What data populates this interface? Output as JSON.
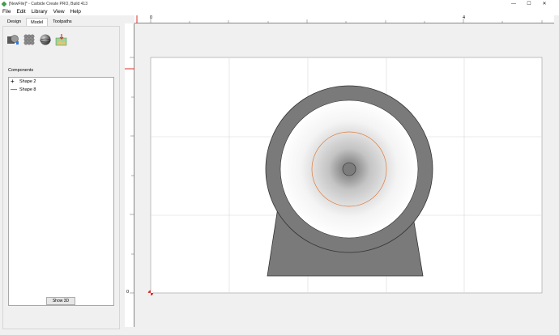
{
  "window": {
    "title": "[NewFile]* - Carbide Create PRO, Build 413",
    "minimize": "—",
    "maximize": "☐",
    "close": "✕"
  },
  "menu": [
    "File",
    "Edit",
    "Library",
    "View",
    "Help"
  ],
  "tabs": [
    {
      "label": "Design",
      "active": false
    },
    {
      "label": "Model",
      "active": true
    },
    {
      "label": "Toolpaths",
      "active": false
    }
  ],
  "tools": [
    "extrude-shape-icon",
    "texture-icon",
    "sphere-icon",
    "import-model-icon"
  ],
  "components": {
    "label": "Components",
    "items": [
      {
        "glyph": "+",
        "label": "Shape 2"
      },
      {
        "glyph": "—",
        "label": "Shape 8"
      }
    ]
  },
  "show3d_label": "Show 3D",
  "ruler": {
    "top_labels": [
      "0",
      "4"
    ],
    "left_labels": [
      "0"
    ]
  },
  "colors": {
    "shape_fill": "#7a7a7a",
    "gradient_center": "#6f6f6f",
    "gradient_edge": "#ffffff",
    "guide_circle": "#e07b3a",
    "origin_marker": "#d9302c"
  }
}
